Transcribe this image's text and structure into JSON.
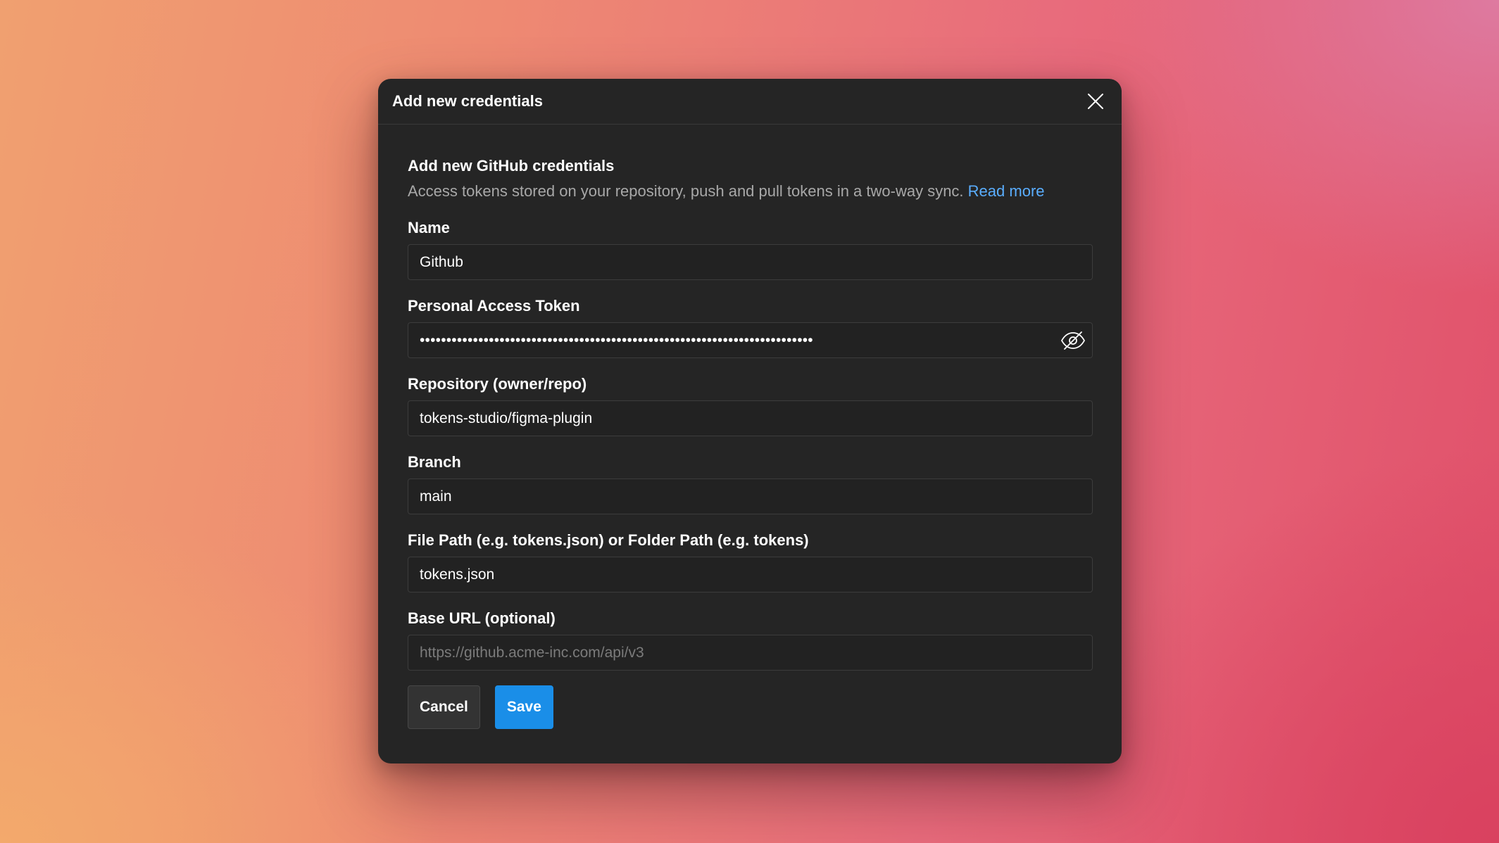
{
  "dialog": {
    "title": "Add new credentials",
    "close_icon": "close-icon"
  },
  "section": {
    "title": "Add new GitHub credentials",
    "description": "Access tokens stored on your repository, push and pull tokens in a two-way sync.",
    "read_more": "Read more"
  },
  "fields": {
    "name": {
      "label": "Name",
      "value": "Github"
    },
    "token": {
      "label": "Personal Access Token",
      "masked_value": "••••••••••••••••••••••••••••••••••••••••••••••••••••••••••••••••••••••••••",
      "toggle_icon": "eye-off-icon"
    },
    "repository": {
      "label": "Repository (owner/repo)",
      "value": "tokens-studio/figma-plugin"
    },
    "branch": {
      "label": "Branch",
      "value": "main"
    },
    "file_path": {
      "label": "File Path (e.g. tokens.json) or Folder Path (e.g. tokens)",
      "value": "tokens.json"
    },
    "base_url": {
      "label": "Base URL (optional)",
      "value": "",
      "placeholder": "https://github.acme-inc.com/api/v3"
    }
  },
  "actions": {
    "cancel_label": "Cancel",
    "save_label": "Save"
  },
  "colors": {
    "dialog_bg": "#252525",
    "accent": "#1a8ee8",
    "link": "#5aaeff"
  }
}
